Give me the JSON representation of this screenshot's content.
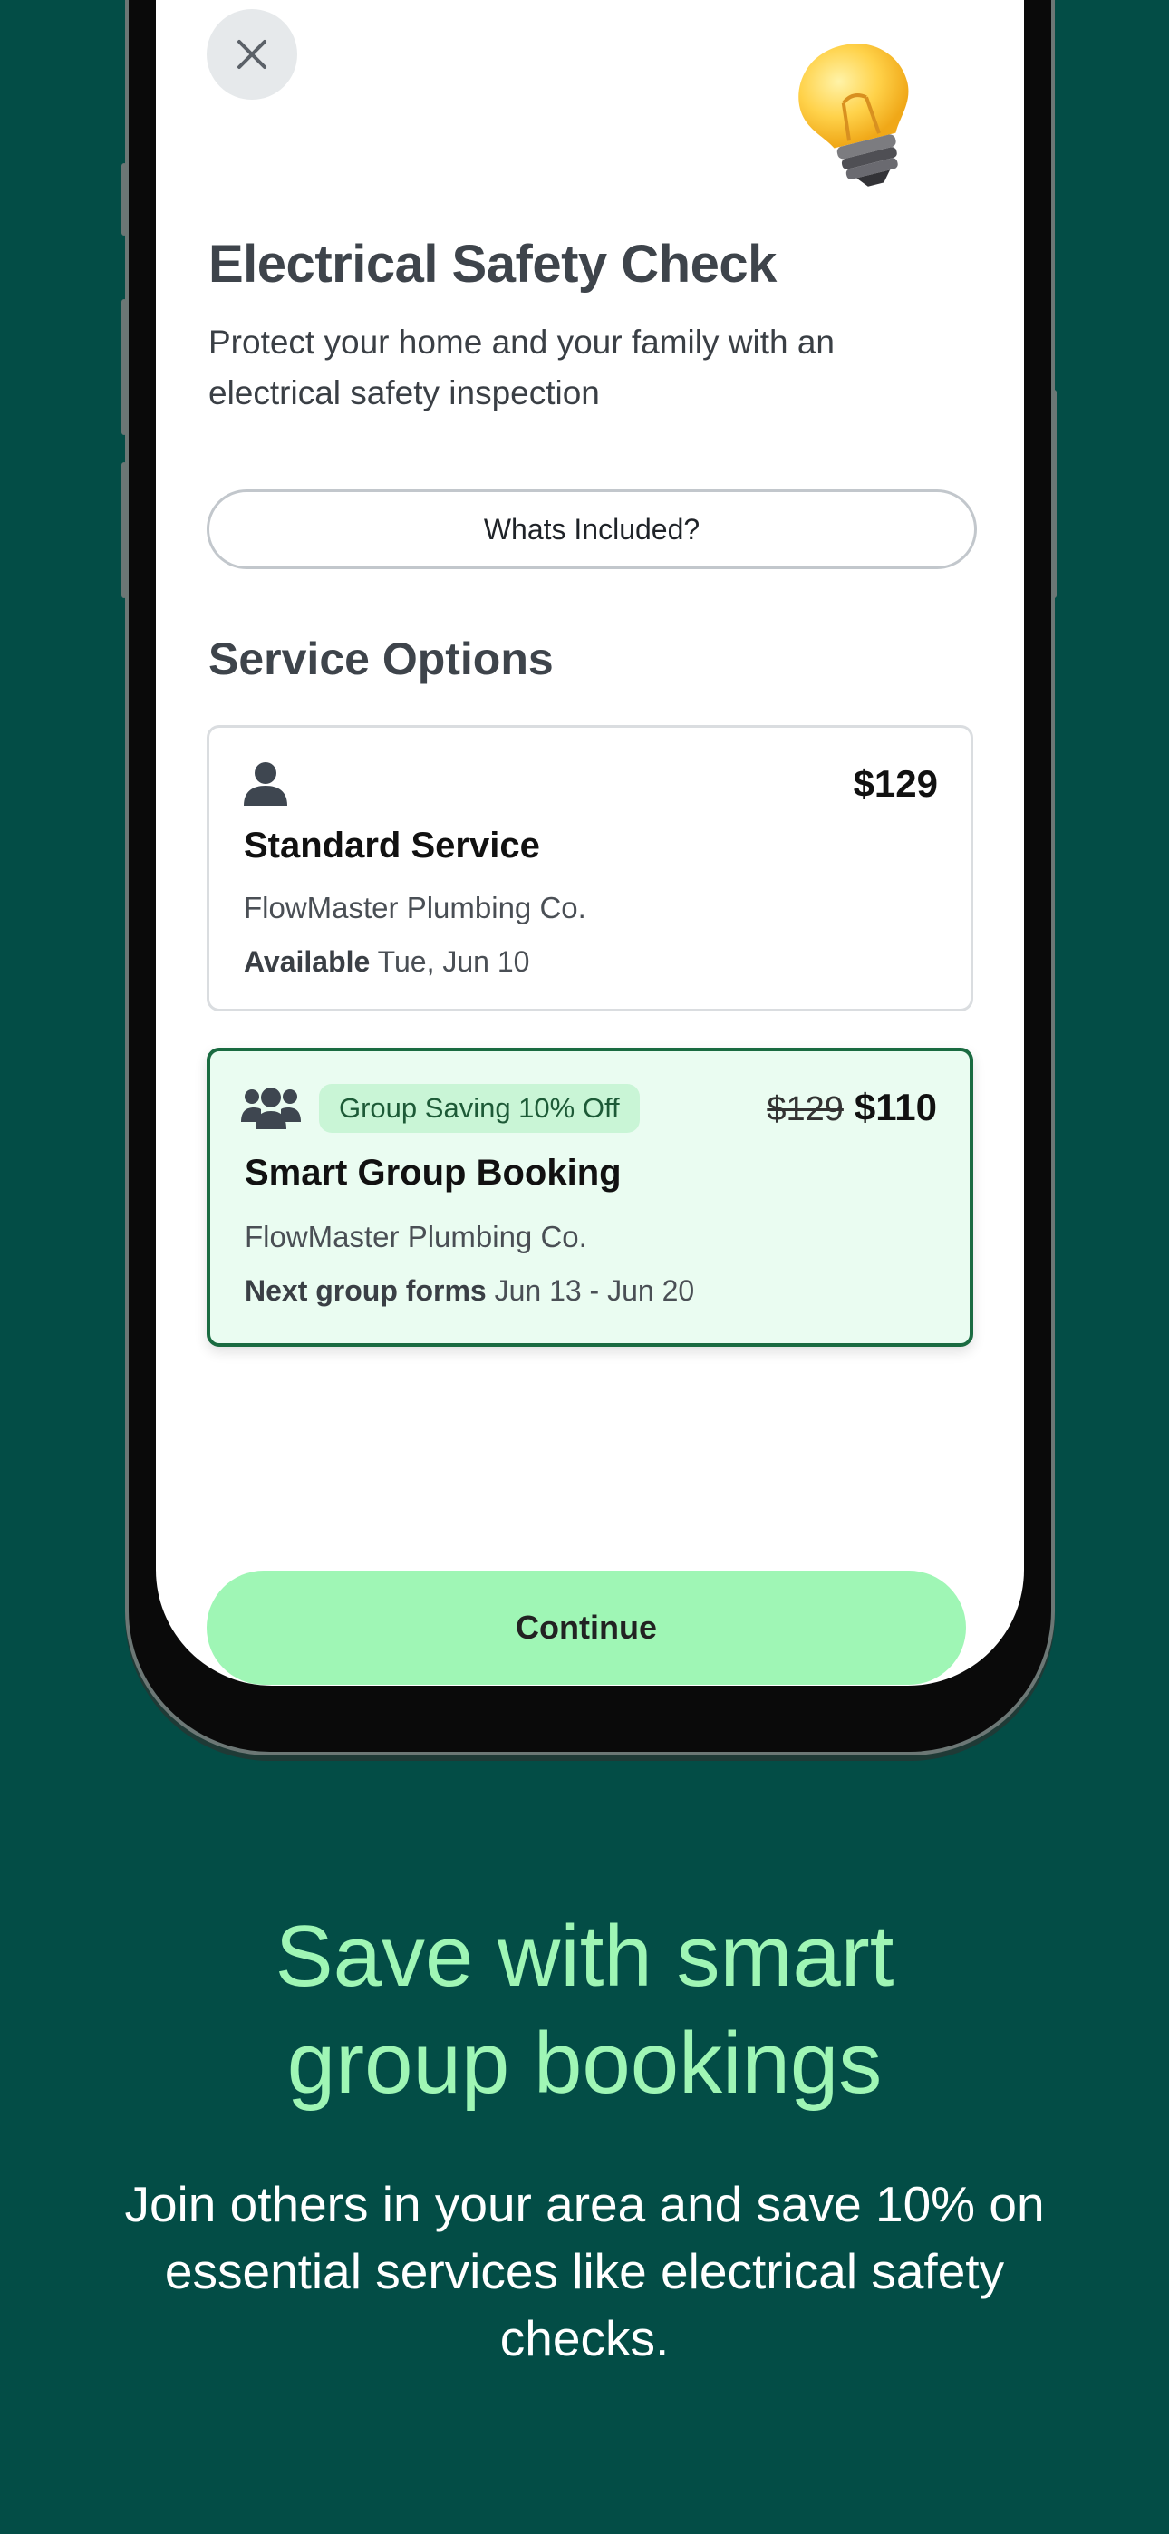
{
  "screen": {
    "close_icon": "close-icon",
    "bulb_icon": "lightbulb-icon",
    "title": "Electrical Safety Check",
    "subtitle": "Protect your home and your family with an electrical safety inspection",
    "included_button": "Whats Included?",
    "section_title": "Service Options",
    "options": [
      {
        "icon": "person-icon",
        "name": "Standard Service",
        "company": "FlowMaster Plumbing Co.",
        "availability_label": "Available",
        "availability_value": "Tue, Jun 10",
        "price": "$129"
      },
      {
        "icon": "group-icon",
        "badge": "Group Saving 10% Off",
        "name": "Smart Group Booking",
        "company": "FlowMaster Plumbing Co.",
        "availability_label": "Next group forms",
        "availability_value": "Jun 13 - Jun 20",
        "old_price": "$129",
        "price": "$110",
        "selected": true
      }
    ],
    "continue_button": "Continue"
  },
  "promo": {
    "headline_line1": "Save with smart",
    "headline_line2": "group bookings",
    "body": "Join others in your area and save 10% on essential services like electrical safety checks."
  },
  "colors": {
    "background": "#034d46",
    "accent_green": "#9ff6b5",
    "selected_card_border": "#1a6b41",
    "selected_card_bg": "#eafcf1"
  }
}
